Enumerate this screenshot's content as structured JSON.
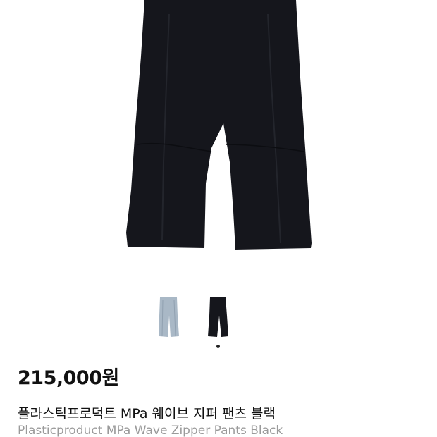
{
  "product": {
    "price": "215,000원",
    "name_ko": "플라스틱프로덕트 MPa 웨이브 지퍼 팬츠 블랙",
    "name_en": "Plasticproduct MPa Wave Zipper Pants Black"
  },
  "gallery": {
    "thumbnails": [
      {
        "color_name": "light-blue",
        "color": "#a9b8c6"
      },
      {
        "color_name": "black",
        "color": "#15161c"
      }
    ],
    "selected_index": 1,
    "indicator_color": "#222222"
  },
  "colors": {
    "pants": "#15161c",
    "price_text": "#111111",
    "subtitle_text": "#9a9a9a"
  }
}
